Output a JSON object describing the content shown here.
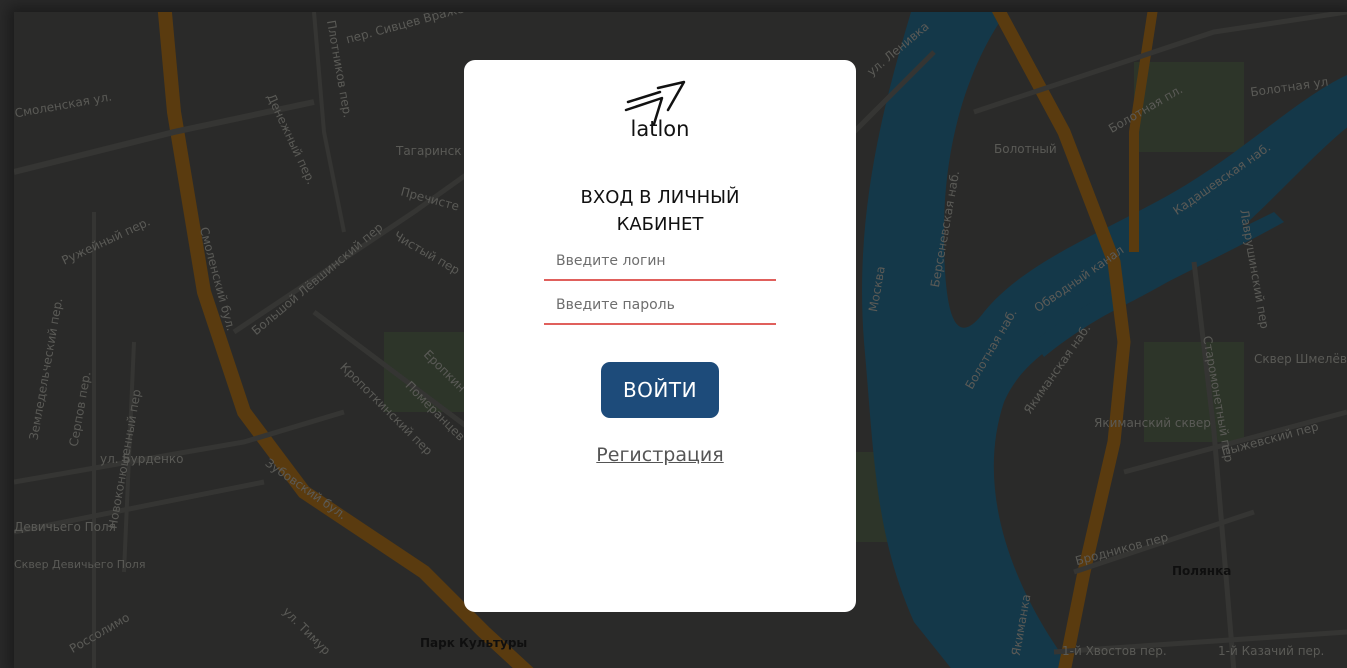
{
  "map": {
    "labels": [
      "пер. Сивцев Вражек",
      "Смоленская ул.",
      "Ружейный пер.",
      "Смоленский бул.",
      "Денежный пер.",
      "Плотников пер.",
      "Тагаринск",
      "Пречисте",
      "Чистый пер",
      "Большой Лёвшинский пер",
      "Земледельческий пер.",
      "Серпов пер.",
      "Новоконюшенный пер",
      "ул. Бурденко",
      "Девичьего Поля",
      "Зубовский бул.",
      "Кропоткинский пер",
      "Померанцев",
      "Еропкин",
      "ул. Тимур",
      "Россолимо",
      "Парк Культуры",
      "ул. Ленивка",
      "Болотная пл.",
      "Болотная ул",
      "Берсеневская наб.",
      "Москва",
      "Болотная наб.",
      "Болотный",
      "Кадашевская наб.",
      "Лаврушинский пер",
      "Старомонетный пер",
      "Якиманская наб.",
      "Якиманский сквер",
      "Пыжевский пер",
      "Бродников пер",
      "Полянка",
      "1-й Хвостов пер.",
      "1-й Казачий пер.",
      "Якиманка",
      "Сквер Шмелёва",
      "Обводный канал",
      "Сквер Девичьего Поля"
    ]
  },
  "card": {
    "logo_text": "latlon",
    "title_line1": "ВХОД В ЛИЧНЫЙ",
    "title_line2": "КАБИНЕТ",
    "login_placeholder": "Введите логин",
    "password_placeholder": "Введите пароль",
    "submit_label": "ВОЙТИ",
    "register_label": "Регистрация"
  },
  "colors": {
    "button": "#1d4b7a",
    "field_underline": "#e0605c",
    "river": "#1a5a7a",
    "road": "#8a5a17"
  }
}
